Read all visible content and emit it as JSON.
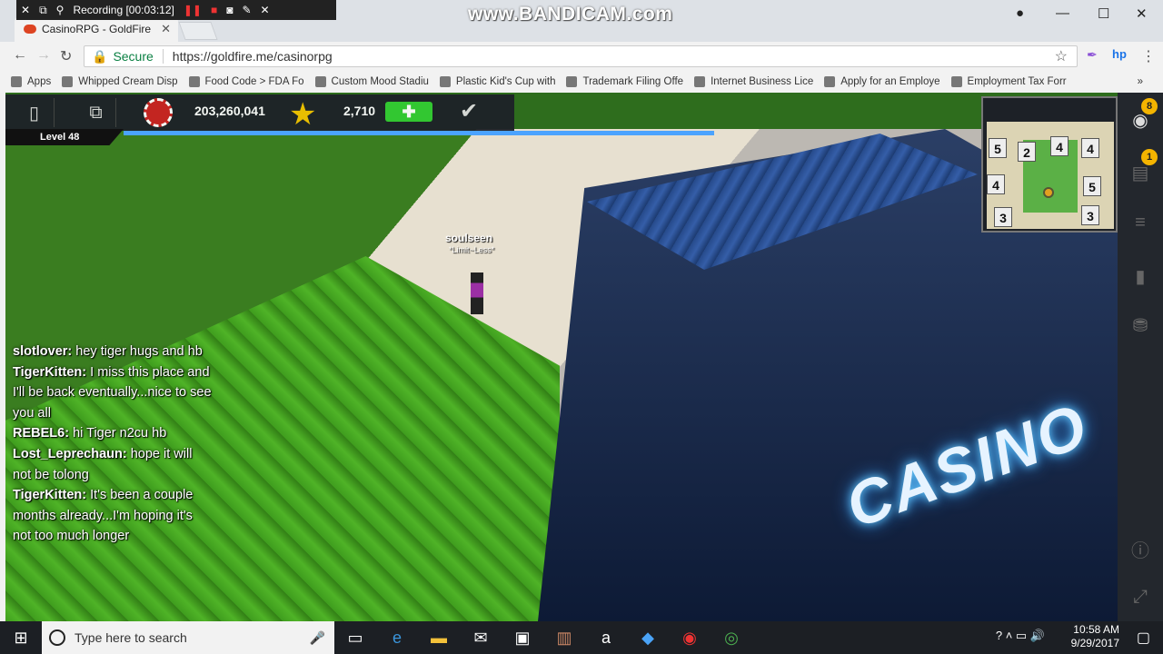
{
  "recorder": {
    "status": "Recording [00:03:12]",
    "watermark": "www.BANDICAM.com"
  },
  "browser": {
    "tab_title": "CasinoRPG - GoldFire",
    "secure_label": "Secure",
    "url": "https://goldfire.me/casinorpg",
    "bookmarks": [
      "Apps",
      "Whipped Cream Disp",
      "Food Code > FDA Fo",
      "Custom Mood Stadiu",
      "Plastic Kid's Cup with",
      "Trademark Filing Offe",
      "Internet Business Lice",
      "Apply for an Employe",
      "Employment Tax Forr"
    ]
  },
  "hud": {
    "chips": "203,260,041",
    "stars": "2,710",
    "level": "Level 48"
  },
  "player": {
    "name": "soulseen",
    "title": "*Limit~Less*"
  },
  "chat": [
    {
      "user": "slotlover:",
      "text": " hey tiger hugs and hb"
    },
    {
      "user": "TigerKitten:",
      "text": " I miss this place and I'll be back eventually...nice to see you all"
    },
    {
      "user": "REBEL6:",
      "text": " hi Tiger n2cu hb"
    },
    {
      "user": "Lost_Leprechaun:",
      "text": " hope it will not be tolong"
    },
    {
      "user": "TigerKitten:",
      "text": " It's been a couple months already...I'm hoping it's not too much longer"
    }
  ],
  "building_sign": "CASINO",
  "minimap": {
    "labels": [
      "5",
      "2",
      "4",
      "4",
      "4",
      "5",
      "3",
      "3"
    ]
  },
  "sidebar": {
    "badge_top": "8",
    "badge_chat": "1"
  },
  "taskbar": {
    "search_placeholder": "Type here to search",
    "time": "10:58 AM",
    "date": "9/29/2017"
  }
}
